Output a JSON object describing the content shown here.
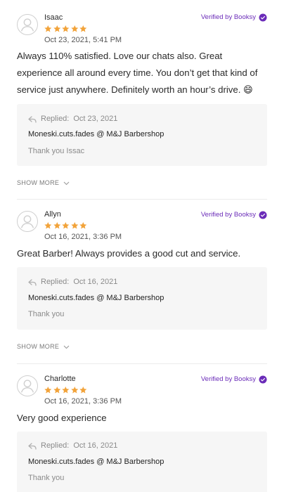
{
  "reviews": [
    {
      "name": "Isaac",
      "rating": 5,
      "date": "Oct 23, 2021, 5:41 PM",
      "verified": "Verified by Booksy",
      "text": "Always 110% satisfied. Love our chats also. Great experience all around every time. You don’t get that kind of service just anywhere. Definitely worth an hour’s drive. 😄",
      "reply": {
        "label": "Replied:",
        "date": "Oct 23, 2021",
        "business": "Moneski.cuts.fades @ M&J Barbershop",
        "text": "Thank you Issac"
      },
      "show_more": "SHOW MORE"
    },
    {
      "name": "Allyn",
      "rating": 5,
      "date": "Oct 16, 2021, 3:36 PM",
      "verified": "Verified by Booksy",
      "text": "Great Barber!  Always provides a good cut and service.",
      "reply": {
        "label": "Replied:",
        "date": "Oct 16, 2021",
        "business": "Moneski.cuts.fades @ M&J Barbershop",
        "text": "Thank you"
      },
      "show_more": "SHOW MORE"
    },
    {
      "name": "Charlotte",
      "rating": 5,
      "date": "Oct 16, 2021, 3:36 PM",
      "verified": "Verified by Booksy",
      "text": "Very good experience",
      "reply": {
        "label": "Replied:",
        "date": "Oct 16, 2021",
        "business": "Moneski.cuts.fades @ M&J Barbershop",
        "text": "Thank you"
      }
    }
  ],
  "colors": {
    "star": "#f2a33a",
    "verified": "#6a2bb8",
    "reply_bg": "#f6f6f6"
  },
  "icons": {
    "avatar": "user-avatar-icon",
    "star": "star-icon",
    "verified": "verified-check-icon",
    "reply": "reply-arrow-icon",
    "chevron": "chevron-down-icon"
  }
}
